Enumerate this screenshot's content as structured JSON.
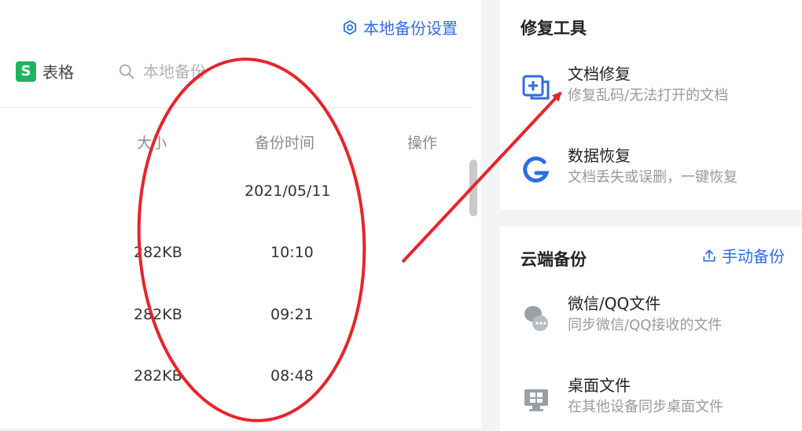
{
  "left": {
    "settings_link": "本地备份设置",
    "sheet_badge": "S",
    "sheet_label": "表格",
    "search_placeholder": "本地备份",
    "columns": {
      "size": "大小",
      "time": "备份时间",
      "action": "操作"
    },
    "date_group": "2021/05/11",
    "rows": [
      {
        "size": "282KB",
        "time": "10:10"
      },
      {
        "size": "282KB",
        "time": "09:21"
      },
      {
        "size": "282KB",
        "time": "08:48"
      }
    ]
  },
  "repair_tools": {
    "title": "修复工具",
    "items": [
      {
        "title": "文档修复",
        "subtitle": "修复乱码/无法打开的文档"
      },
      {
        "title": "数据恢复",
        "subtitle": "文档丢失或误删，一键恢复"
      }
    ]
  },
  "cloud_backup": {
    "title": "云端备份",
    "manual_backup": "手动备份",
    "items": [
      {
        "title": "微信/QQ文件",
        "subtitle": "同步微信/QQ接收的文件"
      },
      {
        "title": "桌面文件",
        "subtitle": "在其他设备同步桌面文件"
      }
    ]
  },
  "colors": {
    "accent": "#2f6de6",
    "sheet_green": "#21b361",
    "annotation_red": "#e8242a",
    "panel_bg": "#f3f4f6"
  },
  "icons": {
    "settings": "gear-icon",
    "search": "search-icon",
    "repair": "document-repair-icon",
    "recovery": "data-recovery-icon",
    "upload": "upload-icon",
    "wechat_qq": "chat-bubbles-icon",
    "desktop": "desktop-window-icon"
  }
}
